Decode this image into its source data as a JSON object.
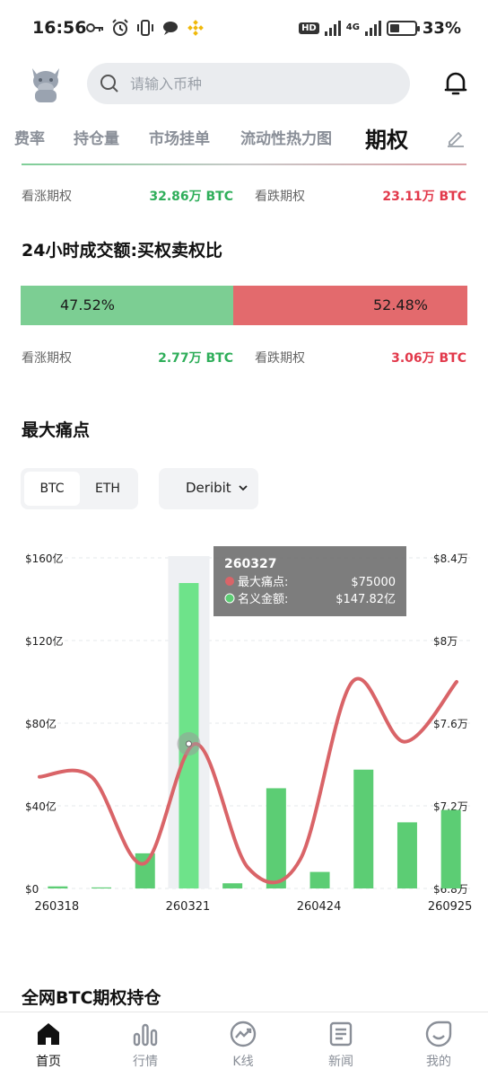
{
  "status_bar": {
    "time": "16:56",
    "hd": "HD",
    "network": "4G",
    "battery": "33%"
  },
  "header": {
    "search_placeholder": "请输入币种"
  },
  "tabs": [
    {
      "label": "费率"
    },
    {
      "label": "持仓量"
    },
    {
      "label": "市场挂单"
    },
    {
      "label": "流动性热力图"
    },
    {
      "label": "期权"
    }
  ],
  "open_interest_row": {
    "call_label": "看涨期权",
    "call_value": "32.86万 BTC",
    "put_label": "看跌期权",
    "put_value": "23.11万 BTC"
  },
  "volume_section": {
    "title": "24小时成交额:买权卖权比",
    "call_pct": "47.52%",
    "put_pct": "52.48%",
    "call_fraction": 0.4752,
    "call_label": "看涨期权",
    "call_value": "2.77万 BTC",
    "put_label": "看跌期权",
    "put_value": "3.06万 BTC"
  },
  "max_pain_section": {
    "title": "最大痛点",
    "coins": [
      "BTC",
      "ETH"
    ],
    "selected_coin": "BTC",
    "exchange": "Deribit"
  },
  "tooltip": {
    "date": "260327",
    "row1_label": "最大痛点:",
    "row1_value": "$75000",
    "row2_label": "名义金额:",
    "row2_value": "$147.82亿"
  },
  "chart_data": {
    "type": "bar",
    "left_axis_ticks": [
      "$0",
      "$40亿",
      "$80亿",
      "$120亿",
      "$160亿"
    ],
    "right_axis_ticks": [
      "$6.8万",
      "$7.2万",
      "$7.6万",
      "$8万",
      "$8.4万"
    ],
    "x_tick_labels": [
      "260318",
      "260321",
      "260424",
      "260925"
    ],
    "ylim_left": [
      0,
      160
    ],
    "ylim_right": [
      68000,
      84000
    ],
    "series": [
      {
        "name": "名义金额",
        "type": "bar",
        "values": [
          1,
          0.5,
          17,
          147.82,
          2.5,
          48.5,
          8,
          57.5,
          32,
          38
        ]
      },
      {
        "name": "最大痛点",
        "type": "line",
        "values": [
          73400,
          73400,
          69200,
          75000,
          69000,
          69400,
          78000,
          75100,
          78000
        ]
      }
    ],
    "bar_color": "#5ccd74",
    "line_color": "#d96468"
  },
  "section_bottom": {
    "title": "全网BTC期权持仓"
  },
  "bottom_nav": [
    {
      "label": "首页"
    },
    {
      "label": "行情"
    },
    {
      "label": "K线"
    },
    {
      "label": "新闻"
    },
    {
      "label": "我的"
    }
  ]
}
